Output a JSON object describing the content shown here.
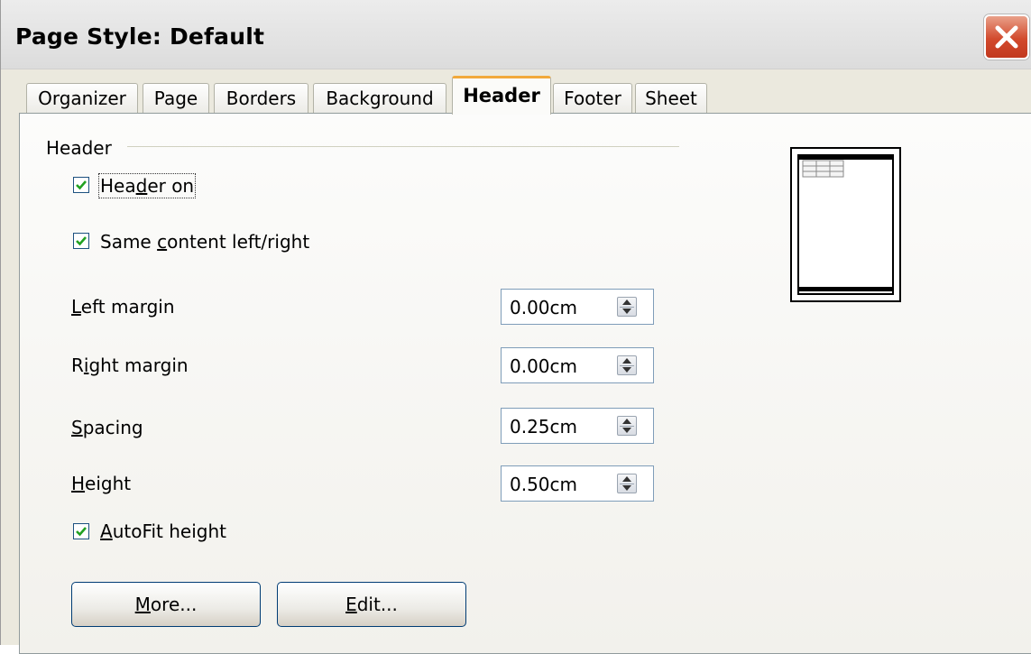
{
  "window": {
    "title": "Page Style: Default"
  },
  "tabs": [
    {
      "label": "Organizer"
    },
    {
      "label": "Page"
    },
    {
      "label": "Borders"
    },
    {
      "label": "Background"
    },
    {
      "label": "Header",
      "active": true
    },
    {
      "label": "Footer"
    },
    {
      "label": "Sheet"
    }
  ],
  "header_section": {
    "title": "Header",
    "header_on": {
      "label_pre": "Hea",
      "label_mnemonic": "d",
      "label_post": "er on",
      "checked": true
    },
    "same_content": {
      "label_pre": "Same ",
      "label_mnemonic": "c",
      "label_post": "ontent left/right",
      "checked": true
    },
    "fields": [
      {
        "label_mnemonic": "L",
        "label_post": "eft margin",
        "value": "0.00cm"
      },
      {
        "label_pre": "R",
        "label_mnemonic": "i",
        "label_post": "ght margin",
        "value": "0.00cm"
      },
      {
        "label_mnemonic": "S",
        "label_post": "pacing",
        "value": "0.25cm"
      },
      {
        "label_mnemonic": "H",
        "label_post": "eight",
        "value": "0.50cm"
      }
    ],
    "autofit": {
      "label_mnemonic": "A",
      "label_post": "utoFit height",
      "checked": true
    },
    "buttons": {
      "more": {
        "mnemonic": "M",
        "rest": "ore..."
      },
      "edit": {
        "mnemonic": "E",
        "rest": "dit..."
      }
    }
  },
  "colors": {
    "check": "#21a121",
    "accent_tab": "#f2a93b",
    "close": "#d24a2d"
  }
}
